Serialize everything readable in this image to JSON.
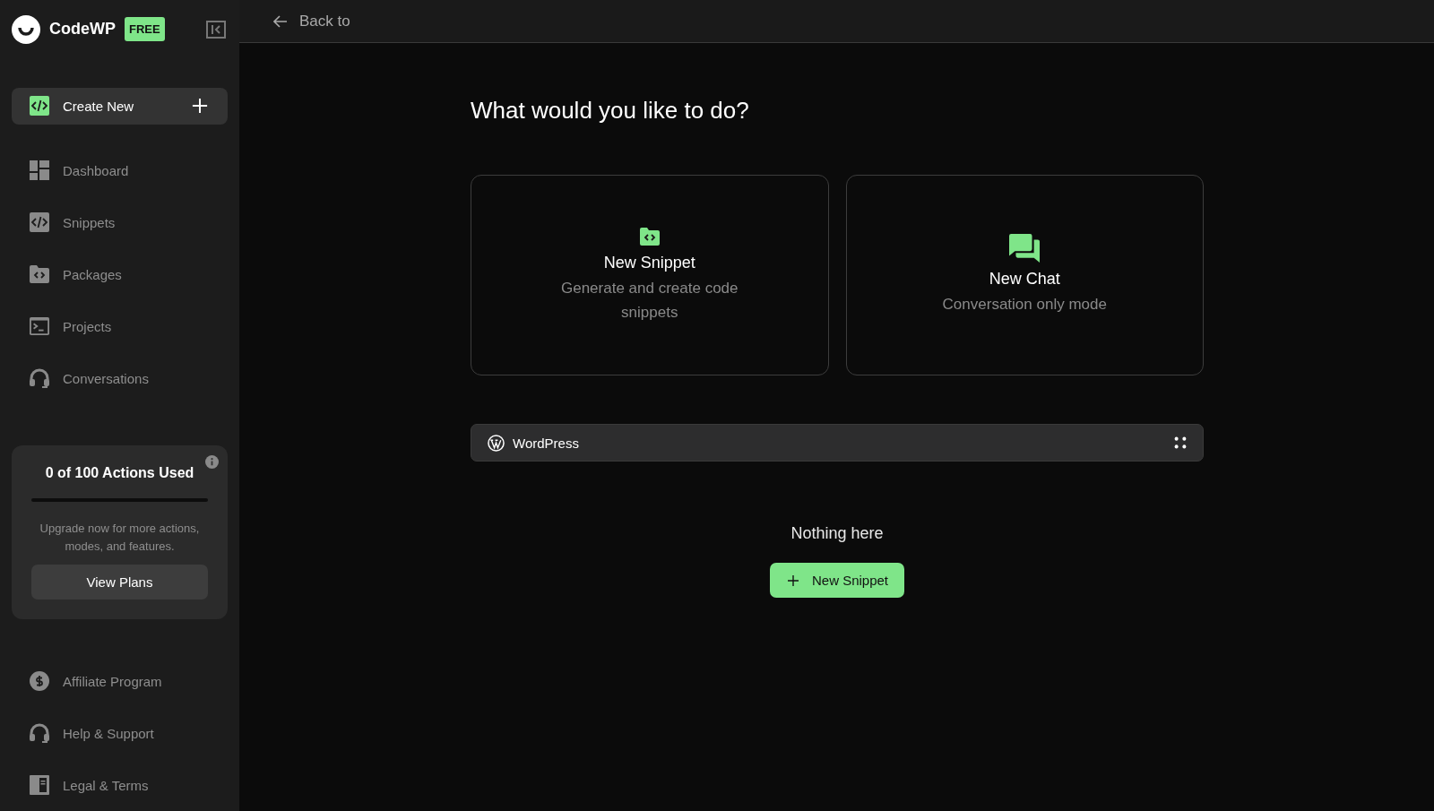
{
  "brand": {
    "name": "CodeWP",
    "badge": "FREE"
  },
  "create_button": {
    "label": "Create New"
  },
  "nav_items": [
    {
      "label": "Dashboard",
      "kind": "dashboard"
    },
    {
      "label": "Snippets",
      "kind": "code"
    },
    {
      "label": "Packages",
      "kind": "folder"
    },
    {
      "label": "Projects",
      "kind": "terminal"
    },
    {
      "label": "Conversations",
      "kind": "headset"
    }
  ],
  "usage_card": {
    "title": "0 of 100 Actions Used",
    "level": 0,
    "text": "Upgrade now for more actions, modes, and features.",
    "button": "View Plans"
  },
  "footer_items": [
    {
      "label": "Affiliate Program",
      "kind": "dollar"
    },
    {
      "label": "Help & Support",
      "kind": "headset"
    },
    {
      "label": "Legal & Terms",
      "kind": "book"
    }
  ],
  "top_bar": {
    "back_link": "Back to"
  },
  "heading": "What would you like to do?",
  "options": [
    {
      "title": "New Snippet",
      "description": "Generate and create code snippets",
      "kind": "folder"
    },
    {
      "title": "New Chat",
      "description": "Conversation only mode",
      "kind": "chat"
    }
  ],
  "platform_bar": {
    "label": "WordPress"
  },
  "empty_state": {
    "message": "Nothing here",
    "button": "New Snippet"
  }
}
